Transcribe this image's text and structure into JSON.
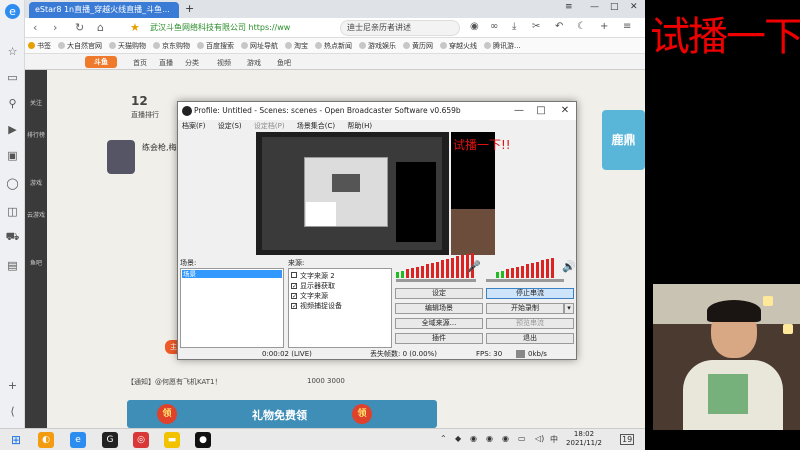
{
  "browser": {
    "tab_title": "eStar8 1n直播_穿越火线直播_斗鱼...",
    "url_domain": "武汉斗鱼网络科技有限公司",
    "url_text": "https://ww",
    "search_text": "迪士尼亲历者讲述",
    "bookmarks": [
      "书签",
      "大自然官网",
      "天猫购物",
      "京东购物",
      "百度搜索",
      "网址导航",
      "淘宝",
      "热点新闻",
      "游戏娱乐",
      "黄历网",
      "穿越火线",
      "腾讯游..."
    ]
  },
  "site": {
    "nav": [
      "首页",
      "直播",
      "分类",
      "视频",
      "游戏",
      "鱼吧"
    ],
    "rail": [
      "关注",
      "排行榜",
      "游戏",
      "云游戏",
      "鱼吧"
    ],
    "follower_count": "12",
    "streamer_name": "练会枪,梅",
    "rank_text": "直播排行",
    "chat_line": "【通知】@何愿有飞机KAT1！",
    "chat_numbers": "1000  3000",
    "banner_text": "礼物免费领",
    "banner_coin": "领",
    "right_ad": "鹿鼎"
  },
  "obs": {
    "title": "Profile: Untitled - Scenes: scenes - Open Broadcaster Software v0.659b",
    "menu": [
      "档案(F)",
      "设定(S)",
      "设定档(P)",
      "场景集合(C)",
      "帮助(H)"
    ],
    "scenes_label": "场景:",
    "sources_label": "来源:",
    "scenes": [
      "场景"
    ],
    "sources": [
      {
        "label": "文字来源 2",
        "checked": false
      },
      {
        "label": "显示器获取",
        "checked": true
      },
      {
        "label": "文字来源",
        "checked": true
      },
      {
        "label": "视频捕捉设备",
        "checked": true
      }
    ],
    "buttons": {
      "settings": "设定",
      "stop_stream": "停止串流",
      "edit_scene": "编辑场景",
      "start_record": "开始录制",
      "global_sources": "全域来源...",
      "preview_stream": "预览串流",
      "plugins": "插件",
      "exit": "退出"
    },
    "status": {
      "time": "0:00:02 (LIVE)",
      "dropped": "丢失帧数: 0 (0.00%)",
      "fps": "FPS: 30",
      "bitrate": "0kb/s"
    },
    "preview_overlay_text": "试播一下!!"
  },
  "overlay_text": "试播一下！！",
  "taskbar": {
    "clock_time": "18:02",
    "clock_date": "2021/11/2",
    "notifications": "19"
  }
}
